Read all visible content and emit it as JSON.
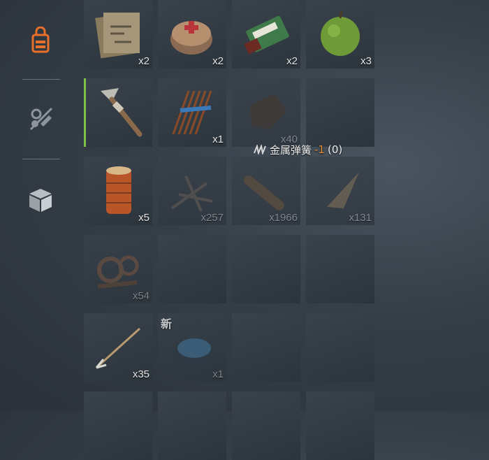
{
  "sidebar": {
    "tabs": [
      {
        "icon": "backpack-icon",
        "active": true
      },
      {
        "icon": "crafting-disabled-icon",
        "active": false
      },
      {
        "icon": "box-icon",
        "active": false
      }
    ],
    "accent_color": "#e8702a"
  },
  "inventory": {
    "rows": [
      [
        {
          "item": "blueprint-map",
          "count": "x2"
        },
        {
          "item": "bandage-roll",
          "count": "x2"
        },
        {
          "item": "green-snack-pack",
          "count": "x2"
        },
        {
          "item": "green-apple",
          "count": "x3"
        }
      ],
      [
        {
          "item": "stone-pickaxe",
          "count": ""
        },
        {
          "item": "arrow-bundle",
          "count": "x1"
        },
        {
          "item": "cloth-scrap",
          "count": "x40"
        },
        {
          "item": "empty",
          "count": ""
        }
      ],
      [
        {
          "item": "thread-spool",
          "count": "x5"
        },
        {
          "item": "twigs",
          "count": "x257"
        },
        {
          "item": "wood-log",
          "count": "x1966"
        },
        {
          "item": "fiber-bundle",
          "count": "x131"
        }
      ],
      [
        {
          "item": "scrap-gears",
          "count": "x54"
        },
        {
          "item": "empty",
          "count": ""
        },
        {
          "item": "empty",
          "count": ""
        },
        {
          "item": "empty",
          "count": ""
        }
      ],
      [
        {
          "item": "wooden-arrow",
          "count": "x35"
        },
        {
          "item": "ceramic-bowl",
          "count": "x1",
          "badge": "新"
        },
        {
          "item": "empty",
          "count": ""
        },
        {
          "item": "empty",
          "count": ""
        }
      ]
    ],
    "selected_color": "#7cc14a"
  },
  "tooltip": {
    "label": "金属弹簧",
    "delta": "-1",
    "remaining": "(0)",
    "icon": "spring-icon"
  }
}
